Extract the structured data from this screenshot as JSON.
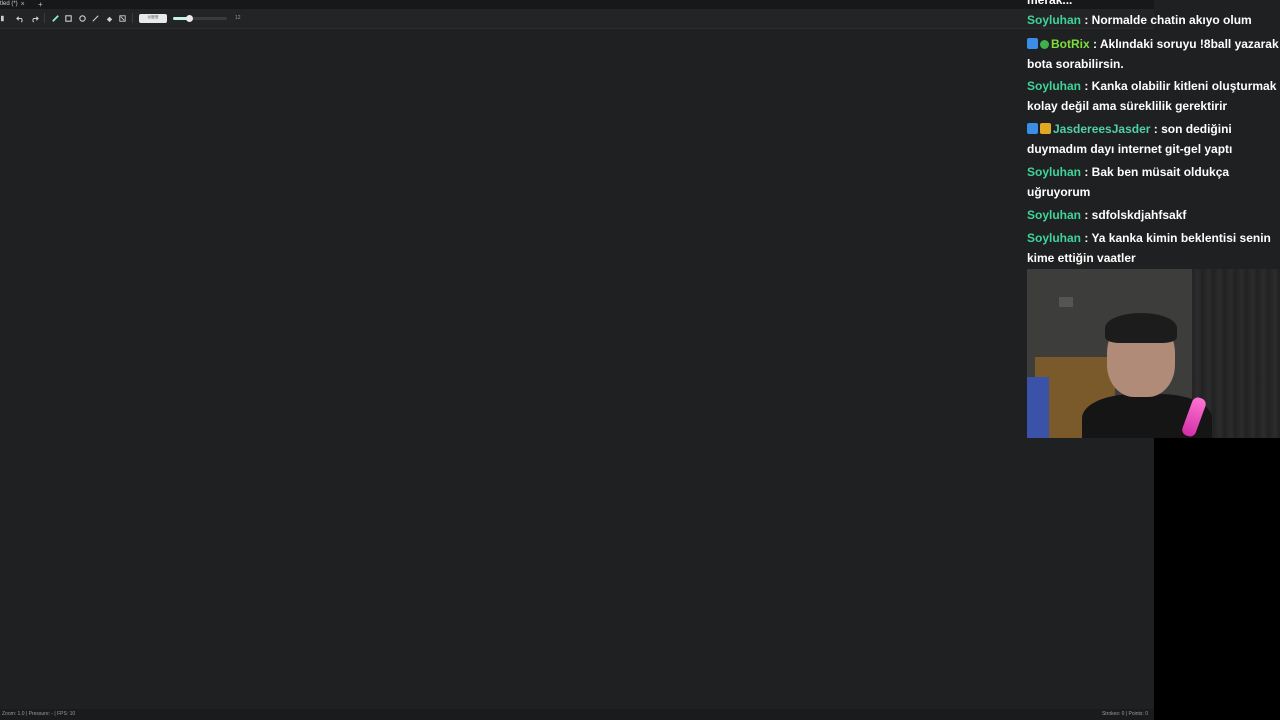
{
  "app": {
    "tab_title": "tled (*)",
    "tab_close": "×",
    "tab_add": "+",
    "toolbar": {
      "color_value": "#ffffff",
      "brush_size": "12",
      "brush_size_fraction": 0.3
    },
    "status_left": "Zoom: 1.0 | Pressure: - | FPS: 10",
    "status_right": "Strokes: 0 | Points: 0"
  },
  "chat": {
    "partial_top": "merak...",
    "messages": [
      {
        "user": "Soyluhan",
        "user_color": "#3fd49a",
        "badges": [],
        "text": ": Normalde chatin akıyo olum"
      },
      {
        "user": "BotRix",
        "user_color": "#7ddf3c",
        "badges": [
          "blue",
          "green"
        ],
        "text": ": Aklındaki soruyu !8ball yazarak bota sorabilirsin."
      },
      {
        "user": "Soyluhan",
        "user_color": "#3fd49a",
        "badges": [],
        "text": ": Kanka olabilir kitleni oluşturmak kolay değil ama süreklilik gerektirir"
      },
      {
        "user": "JasdereesJasder",
        "user_color": "#4fd0a6",
        "badges": [
          "blue",
          "gold"
        ],
        "text": ": son dediğini duymadım dayı internet git-gel yaptı"
      },
      {
        "user": "Soyluhan",
        "user_color": "#3fd49a",
        "badges": [],
        "text": ": Bak ben müsait oldukça uğruyorum"
      },
      {
        "user": "Soyluhan",
        "user_color": "#3fd49a",
        "badges": [],
        "text": ": sdfolskdjahfsakf"
      },
      {
        "user": "Soyluhan",
        "user_color": "#3fd49a",
        "badges": [],
        "text": ": Ya kanka kimin beklentisi senin kime ettiğin vaatler"
      }
    ]
  }
}
